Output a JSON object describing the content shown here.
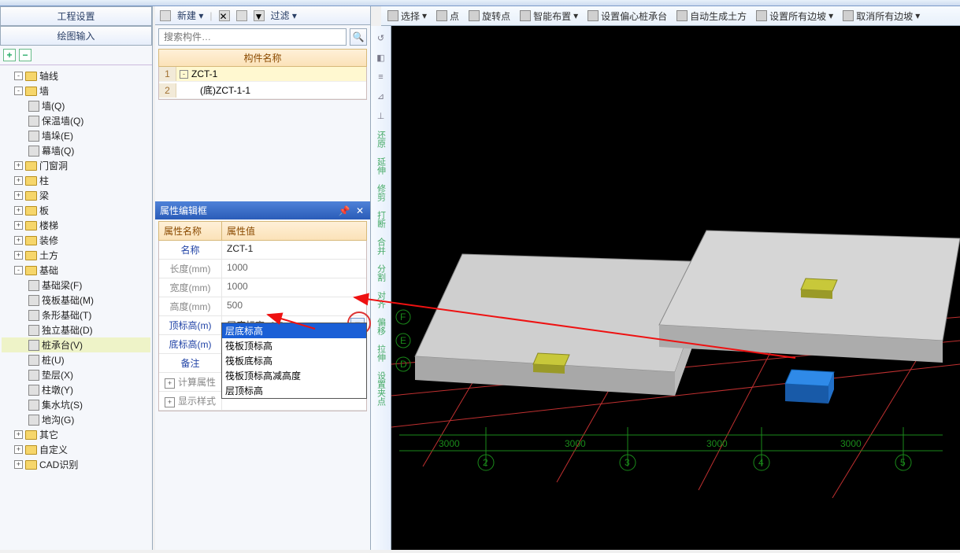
{
  "left_panel": {
    "tab1": "工程设置",
    "tab2": "绘图输入",
    "plus": "+",
    "minus": "−",
    "tree": [
      {
        "lvl": 1,
        "tw": "-",
        "ico": "folder",
        "label": "轴线"
      },
      {
        "lvl": 1,
        "tw": "-",
        "ico": "folder",
        "label": "墙"
      },
      {
        "lvl": 2,
        "ico": "leaf",
        "label": "墙(Q)"
      },
      {
        "lvl": 2,
        "ico": "leaf",
        "label": "保温墙(Q)"
      },
      {
        "lvl": 2,
        "ico": "leaf",
        "label": "墙垛(E)"
      },
      {
        "lvl": 2,
        "ico": "leaf",
        "label": "幕墙(Q)"
      },
      {
        "lvl": 1,
        "tw": "+",
        "ico": "folder",
        "label": "门窗洞"
      },
      {
        "lvl": 1,
        "tw": "+",
        "ico": "folder",
        "label": "柱"
      },
      {
        "lvl": 1,
        "tw": "+",
        "ico": "folder",
        "label": "梁"
      },
      {
        "lvl": 1,
        "tw": "+",
        "ico": "folder",
        "label": "板"
      },
      {
        "lvl": 1,
        "tw": "+",
        "ico": "folder",
        "label": "楼梯"
      },
      {
        "lvl": 1,
        "tw": "+",
        "ico": "folder",
        "label": "装修"
      },
      {
        "lvl": 1,
        "tw": "+",
        "ico": "folder",
        "label": "土方"
      },
      {
        "lvl": 1,
        "tw": "-",
        "ico": "folder",
        "label": "基础"
      },
      {
        "lvl": 2,
        "ico": "leaf",
        "label": "基础梁(F)"
      },
      {
        "lvl": 2,
        "ico": "leaf",
        "label": "筏板基础(M)"
      },
      {
        "lvl": 2,
        "ico": "leaf",
        "label": "条形基础(T)"
      },
      {
        "lvl": 2,
        "ico": "leaf",
        "label": "独立基础(D)"
      },
      {
        "lvl": 2,
        "ico": "leaf",
        "label": "桩承台(V)",
        "sel": true
      },
      {
        "lvl": 2,
        "ico": "leaf",
        "label": "桩(U)"
      },
      {
        "lvl": 2,
        "ico": "leaf",
        "label": "垫层(X)"
      },
      {
        "lvl": 2,
        "ico": "leaf",
        "label": "柱墩(Y)"
      },
      {
        "lvl": 2,
        "ico": "leaf",
        "label": "集水坑(S)"
      },
      {
        "lvl": 2,
        "ico": "leaf",
        "label": "地沟(G)"
      },
      {
        "lvl": 1,
        "tw": "+",
        "ico": "folder",
        "label": "其它"
      },
      {
        "lvl": 1,
        "tw": "+",
        "ico": "folder",
        "label": "自定义"
      },
      {
        "lvl": 1,
        "tw": "+",
        "ico": "folder",
        "label": "CAD识别"
      }
    ]
  },
  "mid_panel": {
    "toolbar": {
      "new": "新建",
      "filter": "过滤"
    },
    "search_placeholder": "搜索构件…",
    "header": "构件名称",
    "rows": [
      {
        "n": "1",
        "txt": "ZCT-1",
        "tw": "-",
        "sel": true
      },
      {
        "n": "2",
        "txt": "(底)ZCT-1-1"
      }
    ]
  },
  "props": {
    "title": "属性编辑框",
    "head_name": "属性名称",
    "head_val": "属性值",
    "rows": [
      {
        "name": "名称",
        "val": "ZCT-1",
        "blue": true,
        "black": true
      },
      {
        "name": "长度(mm)",
        "val": "1000"
      },
      {
        "name": "宽度(mm)",
        "val": "1000"
      },
      {
        "name": "高度(mm)",
        "val": "500"
      },
      {
        "name": "顶标高(m)",
        "val": "层底标高+0.5",
        "blue": true,
        "black": true,
        "dd": true
      },
      {
        "name": "底标高(m)",
        "val": "",
        "blue": true
      },
      {
        "name": "备注",
        "val": "",
        "blue": true
      },
      {
        "name": "计算属性",
        "tw": true
      },
      {
        "name": "显示样式",
        "tw": true
      }
    ],
    "dropdown": [
      "层底标高",
      "筏板顶标高",
      "筏板底标高",
      "筏板顶标高减高度",
      "层顶标高"
    ]
  },
  "vbar": [
    "还原",
    "延伸",
    "修剪",
    "打断",
    "合并",
    "分割",
    "对齐",
    "偏移",
    "拉伸",
    "设置夹点"
  ],
  "toptools": [
    "选择",
    "点",
    "旋转点",
    "智能布置",
    "设置偏心桩承台",
    "自动生成土方",
    "设置所有边坡",
    "取消所有边坡"
  ],
  "viewport": {
    "axis_letters": [
      "F",
      "E",
      "D"
    ],
    "axis_nums": [
      "2",
      "3",
      "4",
      "5"
    ],
    "dims": [
      "3000",
      "3000",
      "3000",
      "3000"
    ]
  }
}
